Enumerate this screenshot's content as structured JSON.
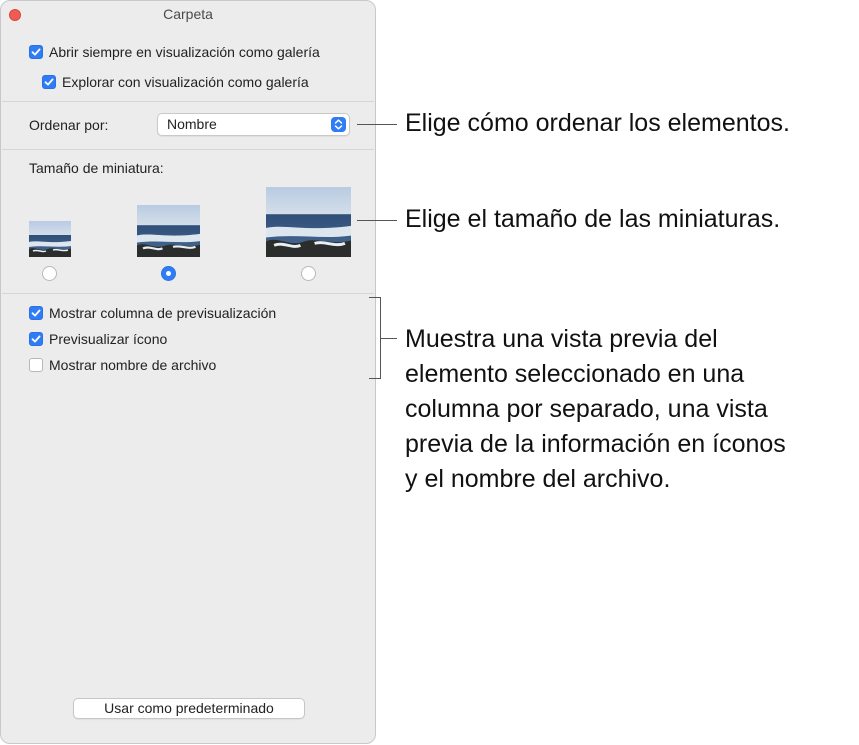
{
  "window": {
    "title": "Carpeta"
  },
  "options_top": [
    {
      "label": "Abrir siempre en visualización como galería",
      "checked": true
    },
    {
      "label": "Explorar con visualización como galería",
      "checked": true
    }
  ],
  "sort": {
    "label": "Ordenar por:",
    "value": "Nombre"
  },
  "thumbnail": {
    "label": "Tamaño de miniatura:",
    "sizes": [
      "small",
      "medium",
      "large"
    ],
    "selected": "medium"
  },
  "options_bottom": [
    {
      "label": "Mostrar columna de previsualización",
      "checked": true
    },
    {
      "label": "Previsualizar ícono",
      "checked": true
    },
    {
      "label": "Mostrar nombre de archivo",
      "checked": false
    }
  ],
  "default_button": {
    "label": "Usar como predeterminado"
  },
  "callouts": {
    "sort": "Elige cómo ordenar los elementos.",
    "thumb": "Elige el tamaño de las miniaturas.",
    "preview": [
      "Muestra una vista previa del",
      "elemento seleccionado en una",
      "columna por separado, una vista",
      "previa de la información en íconos",
      "y el nombre del archivo."
    ]
  },
  "colors": {
    "accent": "#2f7df6",
    "close": "#ee5c54",
    "panel": "#ececec"
  }
}
